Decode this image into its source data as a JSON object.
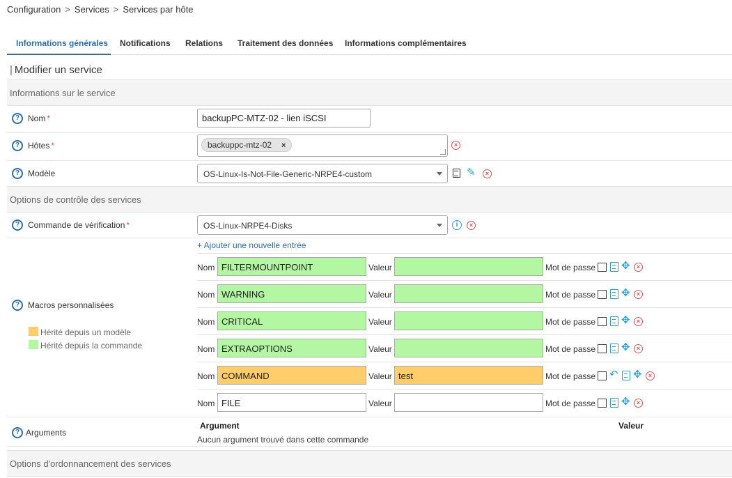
{
  "breadcrumb": [
    "Configuration",
    "Services",
    "Services par hôte"
  ],
  "tabs": [
    "Informations générales",
    "Notifications",
    "Relations",
    "Traitement des données",
    "Informations complémentaires"
  ],
  "page_title": "Modifier un service",
  "sections": {
    "service_info": "Informations sur le service",
    "control_options": "Options de contrôle des services",
    "scheduling_options": "Options d'ordonnancement des services"
  },
  "fields": {
    "name_label": "Nom",
    "name_value": "backupPC-MTZ-02 - lien iSCSI",
    "hosts_label": "Hôtes",
    "hosts_chip": "backuppc-mtz-02",
    "hosts_chip_remove": "×",
    "template_label": "Modèle",
    "template_value": "OS-Linux-Is-Not-File-Generic-NRPE4-custom",
    "check_command_label": "Commande de vérification",
    "check_command_value": "OS-Linux-NRPE4-Disks"
  },
  "macros": {
    "section_label": "Macros personnalisées",
    "add_entry": "+ Ajouter une nouvelle entrée",
    "name_label": "Nom",
    "value_label": "Valeur",
    "password_label": "Mot de passe",
    "legend_template": "Hérité depuis un modèle",
    "legend_command": "Hérité depuis la commande",
    "colors": {
      "template": "#ffce6a",
      "command": "#b3f7a3"
    },
    "rows": [
      {
        "name": "FILTERMOUNTPOINT",
        "value": "",
        "origin": "command"
      },
      {
        "name": "WARNING",
        "value": "",
        "origin": "command"
      },
      {
        "name": "CRITICAL",
        "value": "",
        "origin": "command"
      },
      {
        "name": "EXTRAOPTIONS",
        "value": "",
        "origin": "command"
      },
      {
        "name": "COMMAND",
        "value": "test",
        "origin": "template"
      },
      {
        "name": "FILE",
        "value": "",
        "origin": "none"
      }
    ]
  },
  "arguments": {
    "label": "Arguments",
    "col_argument": "Argument",
    "col_value": "Valeur",
    "empty": "Aucun argument trouvé dans cette commande"
  },
  "help_icon_glyph": "?",
  "required_marker": "*",
  "breadcrumb_sep": ">"
}
